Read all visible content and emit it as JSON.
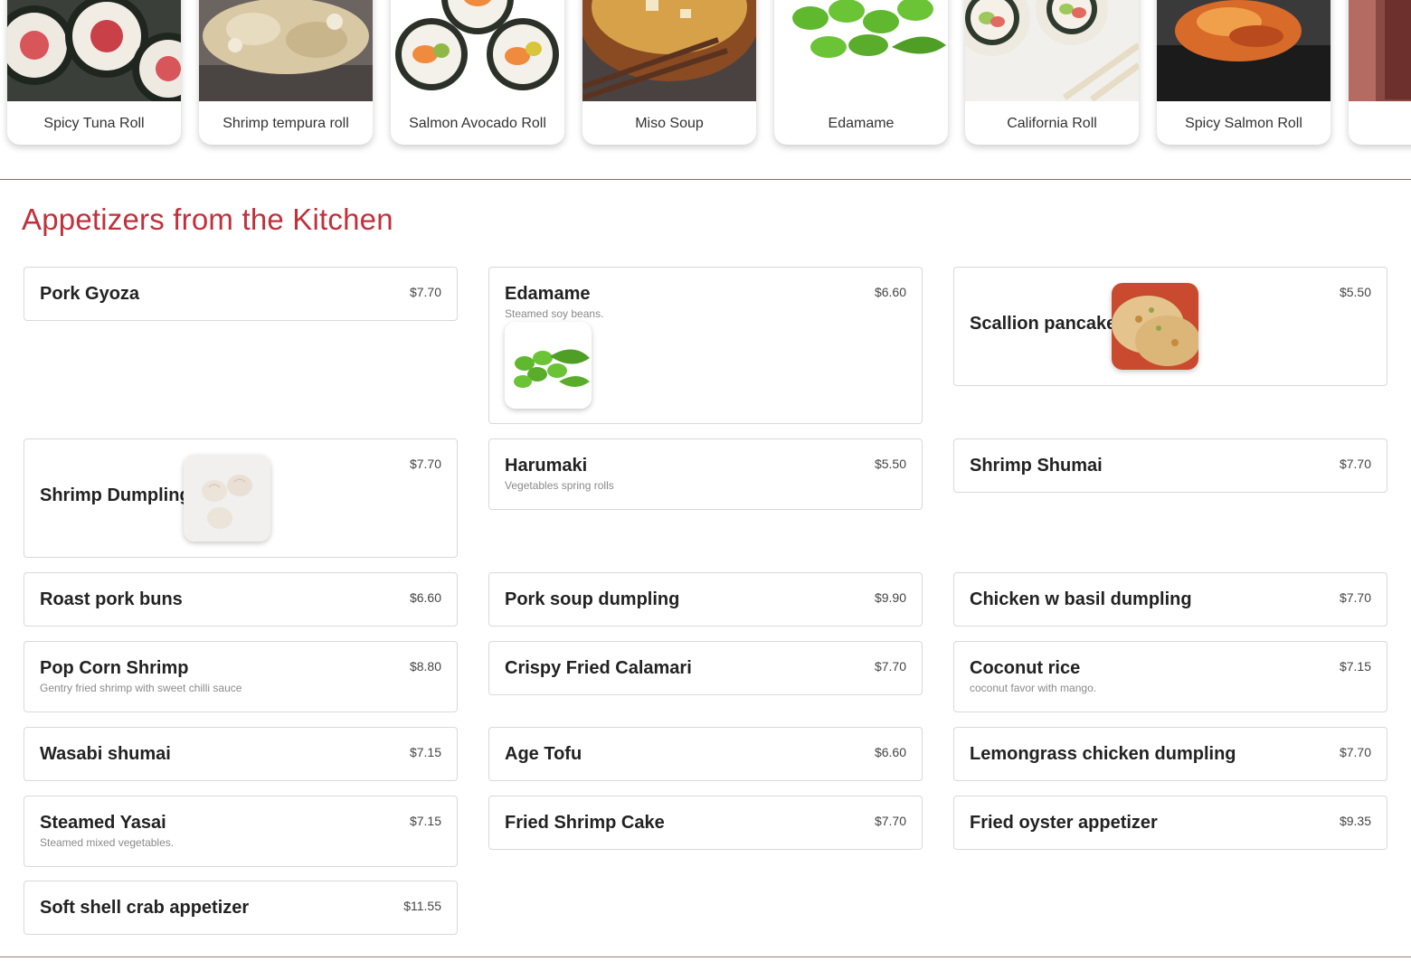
{
  "featured": [
    {
      "label": "Spicy Tuna Roll",
      "image": "sushi-roll-photo"
    },
    {
      "label": "Shrimp tempura roll",
      "image": "tempura-roll-photo"
    },
    {
      "label": "Salmon Avocado Roll",
      "image": "salmon-roll-photo"
    },
    {
      "label": "Miso Soup",
      "image": "miso-soup-photo"
    },
    {
      "label": "Edamame",
      "image": "edamame-photo"
    },
    {
      "label": "California Roll",
      "image": "california-roll-photo"
    },
    {
      "label": "Spicy Salmon Roll",
      "image": "spicy-salmon-roll-photo"
    },
    {
      "label": "",
      "image": "partial-card-photo"
    }
  ],
  "section": {
    "title": "Appetizers from the Kitchen"
  },
  "items": [
    {
      "name": "Pork Gyoza",
      "price": "$7.70"
    },
    {
      "name": "Edamame",
      "description": "Steamed soy beans.",
      "price": "$6.60",
      "image": "edamame-photo"
    },
    {
      "name": "Scallion pancake",
      "price": "$5.50",
      "image": "scallion-pancake-photo"
    },
    {
      "name": "Shrimp Dumpling",
      "price": "$7.70",
      "image": "shrimp-dumpling-photo"
    },
    {
      "name": "Harumaki",
      "description": "Vegetables spring rolls",
      "price": "$5.50"
    },
    {
      "name": "Shrimp Shumai",
      "price": "$7.70"
    },
    {
      "name": "Roast pork buns",
      "price": "$6.60"
    },
    {
      "name": "Pork soup dumpling",
      "price": "$9.90"
    },
    {
      "name": "Chicken w basil dumpling",
      "price": "$7.70"
    },
    {
      "name": "Pop Corn Shrimp",
      "description": "Gentry fried shrimp with sweet chilli sauce",
      "price": "$8.80"
    },
    {
      "name": "Crispy Fried Calamari",
      "price": "$7.70"
    },
    {
      "name": "Coconut rice",
      "description": "coconut favor with mango.",
      "price": "$7.15"
    },
    {
      "name": "Wasabi shumai",
      "price": "$7.15"
    },
    {
      "name": "Age Tofu",
      "price": "$6.60"
    },
    {
      "name": "Lemongrass chicken dumpling",
      "price": "$7.70"
    },
    {
      "name": "Steamed Yasai",
      "description": "Steamed mixed vegetables.",
      "price": "$7.15"
    },
    {
      "name": "Fried Shrimp Cake",
      "price": "$7.70"
    },
    {
      "name": "Fried oyster appetizer",
      "price": "$9.35"
    },
    {
      "name": "Soft shell crab appetizer",
      "price": "$11.55"
    }
  ],
  "colors": {
    "accent": "#c0313c",
    "divider": "#c94a55",
    "border": "#d9d9d9",
    "muted_text": "#8a8a8a"
  }
}
